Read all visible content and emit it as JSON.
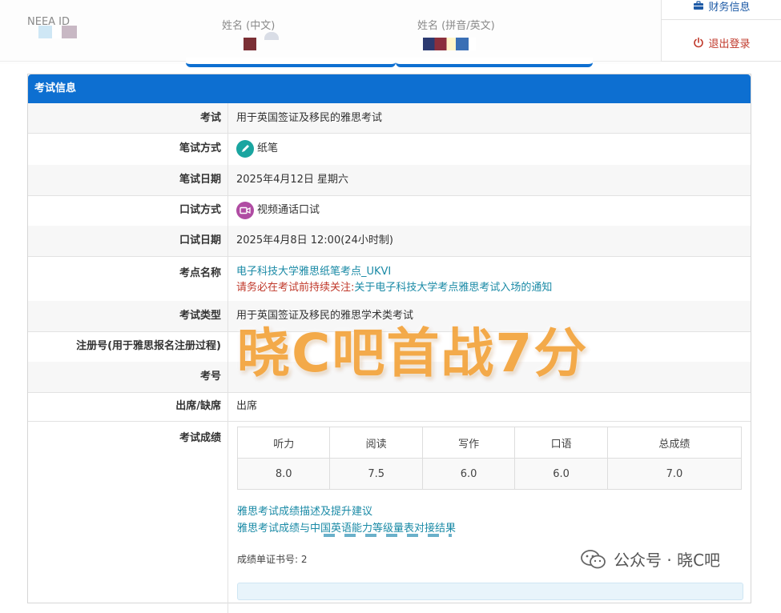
{
  "header": {
    "field1_label": "NEEA ID",
    "field2_label": "姓名 (中文)",
    "field3_label": "姓名 (拼音/英文)"
  },
  "side_menu": {
    "finance": "财务信息",
    "logout": "退出登录"
  },
  "panel": {
    "title": "考试信息",
    "rows": {
      "exam": {
        "label": "考试",
        "value": "用于英国签证及移民的雅思考试"
      },
      "written_mode": {
        "label": "笔试方式",
        "value": "纸笔"
      },
      "written_date": {
        "label": "笔试日期",
        "value": "2025年4月12日 星期六"
      },
      "oral_mode": {
        "label": "口试方式",
        "value": "视频通话口试"
      },
      "oral_date": {
        "label": "口试日期",
        "value": "2025年4月8日 12:00(24小时制)"
      },
      "center": {
        "label": "考点名称",
        "value": "电子科技大学雅思纸笔考点_UKVI",
        "notice_prefix": "请务必在考试前持续关注:",
        "notice_link": "关于电子科技大学考点雅思考试入场的通知"
      },
      "exam_type": {
        "label": "考试类型",
        "value": "用于英国签证及移民的雅思学术类考试"
      },
      "reg_no": {
        "label": "注册号(用于雅思报名注册过程)"
      },
      "candidate_no": {
        "label": "考号"
      },
      "attendance": {
        "label": "出席/缺席",
        "value": "出席"
      },
      "scores": {
        "label": "考试成绩"
      }
    }
  },
  "score_table": {
    "headers": [
      "听力",
      "阅读",
      "写作",
      "口语",
      "总成绩"
    ],
    "values": [
      "8.0",
      "7.5",
      "6.0",
      "6.0",
      "7.0"
    ]
  },
  "links": {
    "desc": "雅思考试成绩描述及提升建议",
    "cefr": "雅思考试成绩与中国英语能力等级量表对接结果"
  },
  "cert": "成绩单证书号: 2",
  "watermark": "晓C吧首战7分",
  "wechat": "公众号 · 晓C吧",
  "colors": {
    "header_blue": "#0d6fd1",
    "accent_orange": "#f3a33b",
    "link": "#1a8aa6",
    "warn": "#c0392b"
  }
}
